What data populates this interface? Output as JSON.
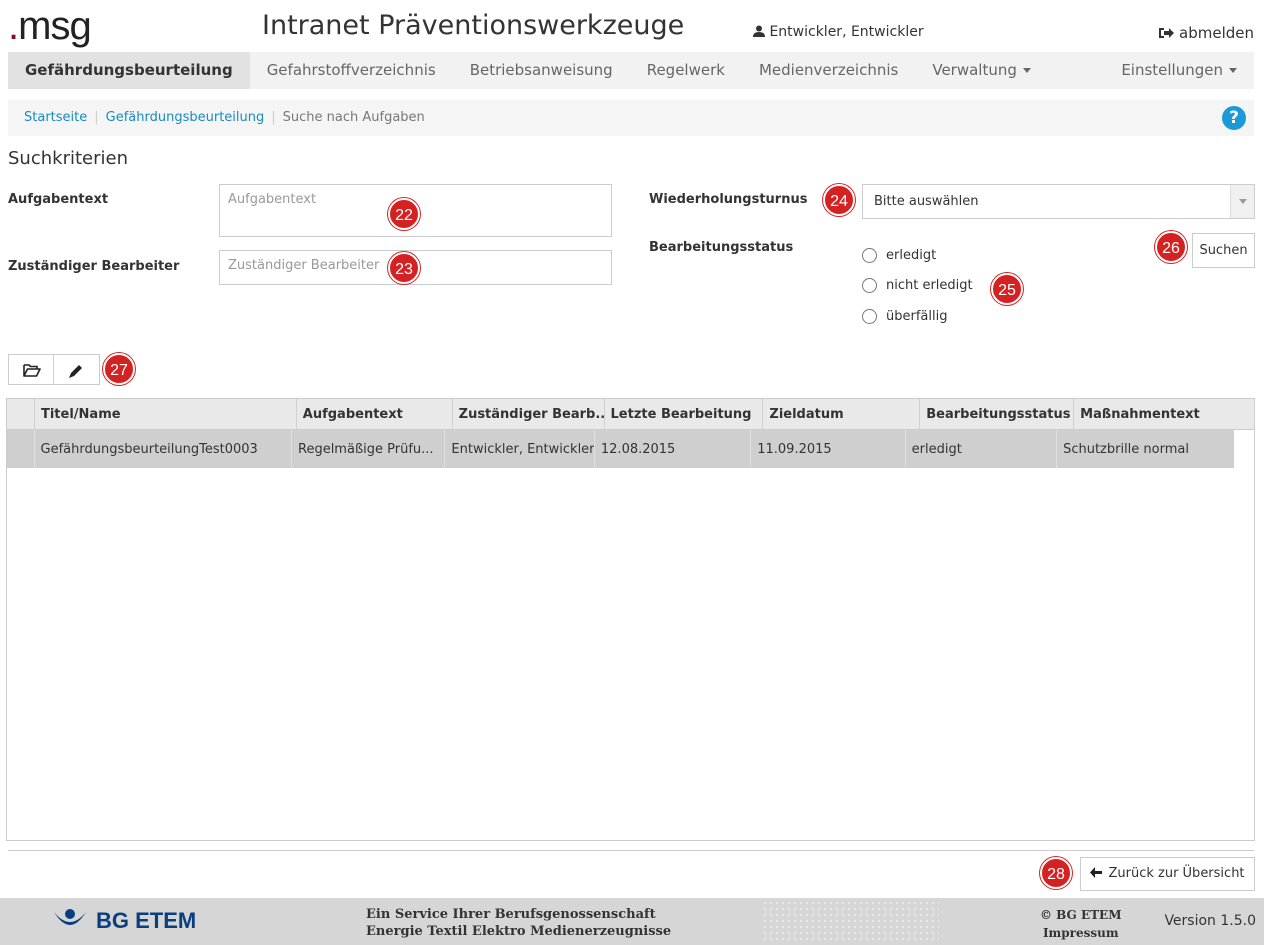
{
  "header": {
    "logo_dot": ".",
    "logo_text": "msg",
    "title": "Intranet Präventionswerkzeuge",
    "user": "Entwickler, Entwickler",
    "logout": "abmelden"
  },
  "nav": {
    "items": [
      {
        "label": "Gefährdungsbeurteilung",
        "active": true
      },
      {
        "label": "Gefahrstoffverzeichnis"
      },
      {
        "label": "Betriebsanweisung"
      },
      {
        "label": "Regelwerk"
      },
      {
        "label": "Medienverzeichnis"
      },
      {
        "label": "Verwaltung"
      },
      {
        "label": "Einstellungen"
      }
    ]
  },
  "breadcrumb": {
    "home": "Startseite",
    "section": "Gefährdungsbeurteilung",
    "current": "Suche nach Aufgaben",
    "help": "?"
  },
  "search": {
    "section_title": "Suchkriterien",
    "task_label": "Aufgabentext",
    "task_placeholder": "Aufgabentext",
    "assignee_label": "Zuständiger Bearbeiter",
    "assignee_placeholder": "Zuständiger Bearbeiter",
    "repeat_label": "Wiederholungsturnus",
    "repeat_value": "Bitte auswählen",
    "status_label": "Bearbeitungsstatus",
    "status_options": [
      "erledigt",
      "nicht erledigt",
      "überfällig"
    ],
    "search_button": "Suchen"
  },
  "badges": [
    "22",
    "23",
    "24",
    "25",
    "26",
    "27",
    "28"
  ],
  "toolbar": {
    "open_icon": "folder-open-icon",
    "edit_icon": "pencil-icon"
  },
  "grid": {
    "columns": [
      "Titel/Name",
      "Aufgabentext",
      "Zuständiger Bearb...",
      "Letzte Bearbeitung",
      "Zieldatum",
      "Bearbeitungsstatus",
      "Maßnahmentext"
    ],
    "rows": [
      [
        "GefährdungsbeurteilungTest0003",
        "Regelmäßige Prüfu...",
        "Entwickler, Entwickler",
        "12.08.2015",
        "11.09.2015",
        "erledigt",
        "Schutzbrille normal"
      ]
    ]
  },
  "back_button": "Zurück zur Übersicht",
  "footer": {
    "brand": "BG ETEM",
    "service_line1": "Ein Service Ihrer Berufsgenossenschaft",
    "service_line2": "Energie Textil Elektro Medienerzeugnisse",
    "copyright": "© BG ETEM",
    "imprint": "Impressum",
    "version": "Version 1.5.0"
  },
  "colors": {
    "accent": "#1a8bbd",
    "badge": "#d42222",
    "brand_dot": "#8a0a2e",
    "bg_blue": "#0a3f7f"
  }
}
